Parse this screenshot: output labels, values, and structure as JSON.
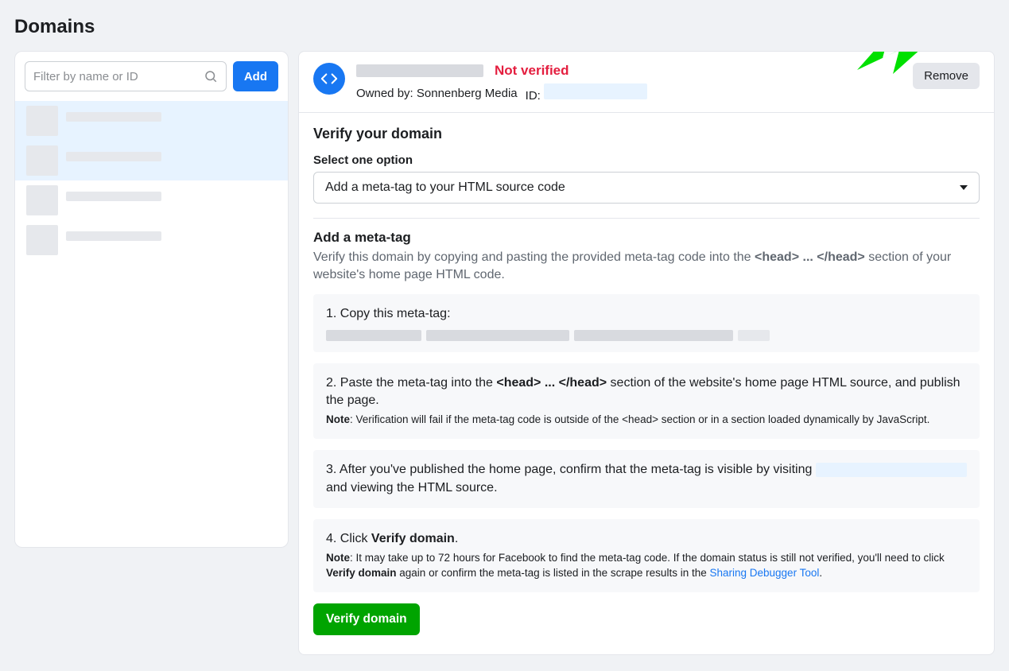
{
  "pageTitle": "Domains",
  "sidebar": {
    "filterPlaceholder": "Filter by name or ID",
    "addLabel": "Add"
  },
  "header": {
    "notVerified": "Not verified",
    "ownedByLabel": "Owned by:",
    "ownedByValue": "Sonnenberg Media",
    "idLabel": "ID:",
    "removeLabel": "Remove"
  },
  "content": {
    "verifyTitle": "Verify your domain",
    "selectLabel": "Select one option",
    "selectedOption": "Add a meta-tag to your HTML source code",
    "metaSection": {
      "title": "Add a meta-tag",
      "descPrefix": "Verify this domain by copying and pasting the provided meta-tag code into the ",
      "descBold": "<head> ... </head>",
      "descSuffix": " section of your website's home page HTML code."
    },
    "step1": {
      "text": "1. Copy this meta-tag:"
    },
    "step2": {
      "prefix": "2. Paste the meta-tag into the ",
      "bold": "<head> ... </head>",
      "suffix": " section of the website's home page HTML source, and publish the page.",
      "noteLabel": "Note",
      "noteText": ": Verification will fail if the meta-tag code is outside of the <head> section or in a section loaded dynamically by JavaScript."
    },
    "step3": {
      "prefix": "3. After you've published the home page, confirm that the meta-tag is visible by visiting ",
      "suffix": " and viewing the HTML source."
    },
    "step4": {
      "prefix": "4. Click ",
      "bold": "Verify domain",
      "suffix": ".",
      "noteLabel": "Note",
      "notePart1": ": It may take up to 72 hours for Facebook to find the meta-tag code. If the domain status is still not verified, you'll need to click ",
      "noteBold": "Verify domain",
      "notePart2": " again or confirm the meta-tag is listed in the scrape results in the ",
      "linkText": "Sharing Debugger Tool",
      "notePart3": "."
    },
    "verifyButton": "Verify domain"
  }
}
